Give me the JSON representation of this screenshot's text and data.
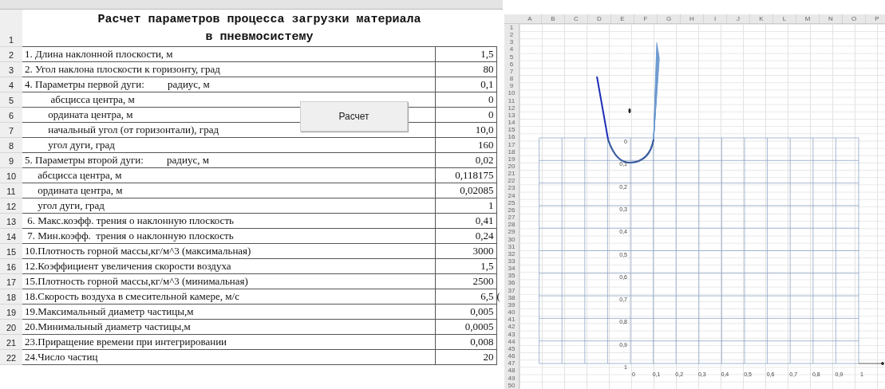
{
  "left_sheet": {
    "title": [
      "Расчет параметров процесса загрузки материала",
      "в пневмосистему"
    ],
    "title_row": "1",
    "rows": [
      {
        "row": "2",
        "label": "1. Длина наклонной плоскости, м",
        "value": "1,5"
      },
      {
        "row": "3",
        "label": "2. Угол наклона плоскости к горизонту, град",
        "value": "80"
      },
      {
        "row": "4",
        "label": "4. Параметры первой дуги:         радиус, м",
        "value": "0,1"
      },
      {
        "row": "5",
        "label": "          абсцисса центра, м",
        "value": "0"
      },
      {
        "row": "6",
        "label": "         ордината центра, м",
        "value": "0"
      },
      {
        "row": "7",
        "label": "         начальный угол (от горизонтали), град",
        "value": "10,0"
      },
      {
        "row": "8",
        "label": "         угол дуги, град",
        "value": "160"
      },
      {
        "row": "9",
        "label": "5. Параметры второй дуги:         радиус, м",
        "value": "0,02"
      },
      {
        "row": "10",
        "label": "     абсцисса центра, м",
        "value": "0,118175"
      },
      {
        "row": "11",
        "label": "     ордината центра, м",
        "value": "0,02085"
      },
      {
        "row": "12",
        "label": "     угол дуги, град",
        "value": "1"
      },
      {
        "row": "13",
        "label": " 6. Макс.коэфф. трения о наклонную плоскость",
        "value": "0,41"
      },
      {
        "row": "14",
        "label": " 7. Мин.коэфф.  трения о наклонную плоскость",
        "value": "0,24"
      },
      {
        "row": "15",
        "label": "10.Плотность горной массы,кг/м^3 (максимальная)",
        "value": "3000"
      },
      {
        "row": "16",
        "label": "12.Коэффициент увеличения скорости воздуха",
        "value": "1,5"
      },
      {
        "row": "17",
        "label": "15.Плотность горной массы,кг/м^3 (минимальная)",
        "value": "2500"
      },
      {
        "row": "18",
        "label": "18.Скорость воздуха в смесительной камере, м/с",
        "value": "6,5",
        "column_4": "("
      },
      {
        "row": "19",
        "label": "19.Максимальный диаметр частицы,м",
        "value": "0,005"
      },
      {
        "row": "20",
        "label": "20.Минимальный диаметр частицы,м",
        "value": "0,0005"
      },
      {
        "row": "21",
        "label": "23.Приращение времени при интегрировании",
        "value": "0,008"
      },
      {
        "row": "22",
        "label": "24.Число частиц",
        "value": "20"
      }
    ],
    "button": "Расчет"
  },
  "right_sheet": {
    "columns": [
      "A",
      "B",
      "C",
      "D",
      "E",
      "F",
      "G",
      "H",
      "I",
      "J",
      "K",
      "L",
      "M",
      "N",
      "O",
      "P"
    ],
    "rows": [
      "1",
      "2",
      "3",
      "4",
      "5",
      "6",
      "7",
      "8",
      "9",
      "10",
      "11",
      "12",
      "13",
      "14",
      "15",
      "16",
      "17",
      "18",
      "19",
      "20",
      "21",
      "22",
      "23",
      "24",
      "25",
      "26",
      "27",
      "28",
      "29",
      "30",
      "31",
      "32",
      "33",
      "34",
      "35",
      "36",
      "37",
      "38",
      "39",
      "40",
      "41",
      "42",
      "43",
      "44",
      "45",
      "46",
      "47",
      "48",
      "49",
      "50"
    ],
    "y_tick_labels": [
      "0",
      "0,1",
      "0,2",
      "0,3",
      "0,4",
      "0,5",
      "0,6",
      "0,7",
      "0,8",
      "0,9",
      "1"
    ],
    "x_tick_labels": [
      "0",
      "0,1",
      "0,2",
      "0,3",
      "0,4",
      "0,5",
      "0,6",
      "0,7",
      "0,8",
      "0,9",
      "1"
    ]
  }
}
